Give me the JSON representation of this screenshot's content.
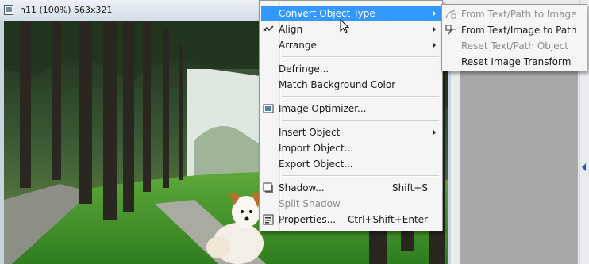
{
  "window": {
    "title": "h11 (100%) 563x321"
  },
  "context_menu": {
    "items": [
      {
        "label": "Convert Object Type",
        "submenu": true,
        "highlighted": true
      },
      {
        "label": "Align",
        "submenu": true
      },
      {
        "label": "Arrange",
        "submenu": true
      },
      {
        "label": "Defringe..."
      },
      {
        "label": "Match Background Color"
      },
      {
        "label": "Image Optimizer..."
      },
      {
        "label": "Insert Object",
        "submenu": true
      },
      {
        "label": "Import Object..."
      },
      {
        "label": "Export Object..."
      },
      {
        "label": "Shadow...",
        "shortcut": "Shift+S"
      },
      {
        "label": "Split Shadow",
        "disabled": true
      },
      {
        "label": "Properties...",
        "shortcut": "Ctrl+Shift+Enter"
      }
    ]
  },
  "submenu": {
    "items": [
      {
        "label": "From Text/Path to Image",
        "disabled": true
      },
      {
        "label": "From Text/Image to Path"
      },
      {
        "label": "Reset Text/Path Object",
        "disabled": true
      },
      {
        "label": "Reset Image Transform"
      }
    ]
  },
  "colors": {
    "highlight": "#3399ff",
    "menu_background": "#f5f5f5",
    "disabled_text": "#8c8c8c"
  }
}
